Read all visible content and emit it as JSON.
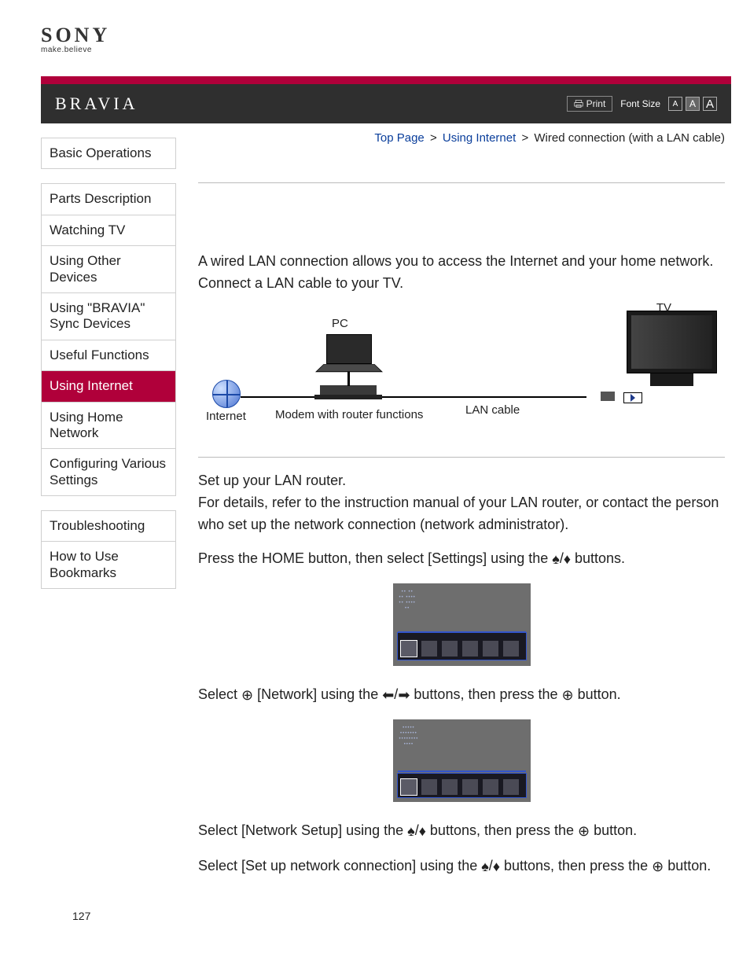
{
  "logo": {
    "brand": "SONY",
    "tagline": "make.believe"
  },
  "product": "BRAVIA",
  "toolbar": {
    "print": "Print",
    "fontsize_label": "Font Size",
    "a_s": "A",
    "a_m": "A",
    "a_l": "A"
  },
  "breadcrumb": {
    "top": "Top Page",
    "sep": ">",
    "l2": "Using Internet",
    "cur": "Wired connection (with a LAN cable)"
  },
  "sidebar": {
    "g1": [
      "Basic Operations"
    ],
    "g2": [
      "Parts Description",
      "Watching TV",
      "Using Other Devices",
      "Using \"BRAVIA\" Sync Devices",
      "Useful Functions",
      "Using Internet",
      "Using Home Network",
      "Configuring Various Settings"
    ],
    "g3": [
      "Troubleshooting",
      "How to Use Bookmarks"
    ],
    "active": "Using Internet"
  },
  "content": {
    "intro": "A wired LAN connection allows you to access the Internet and your home network. Connect a LAN cable to your TV.",
    "diagram": {
      "pc": "PC",
      "tv": "TV",
      "internet": "Internet",
      "modem": "Modem with router functions",
      "lan": "LAN cable"
    },
    "step_a": "Set up your LAN router.",
    "step_a_detail": "For details, refer to the instruction manual of your LAN router, or contact the person who set up the network connection (network administrator).",
    "step_b_pre": "Press the HOME button, then select [Settings] using the ",
    "step_b_post": " buttons.",
    "step_c_pre": "Select ",
    "step_c_mid1": " [Network] using the ",
    "step_c_mid2": " buttons, then press the ",
    "step_c_post": " button.",
    "step_d_pre": "Select [Network Setup] using the ",
    "step_d_mid": " buttons, then press the ",
    "step_d_post": " button.",
    "step_e_pre": "Select [Set up network connection] using the ",
    "step_e_mid": " buttons, then press the ",
    "step_e_post": " button."
  },
  "pagenum": "127"
}
